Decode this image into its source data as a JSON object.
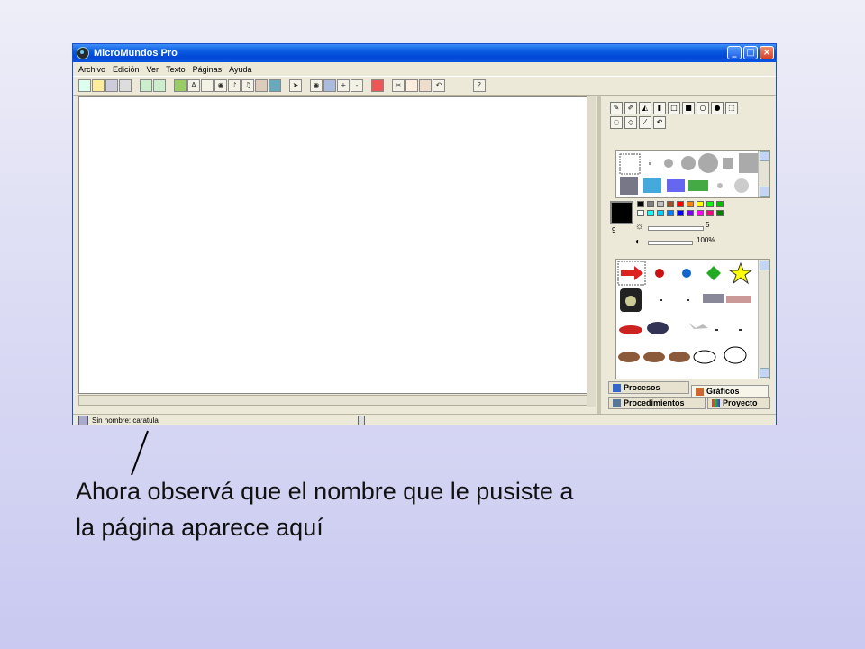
{
  "window": {
    "title": "MicroMundos Pro",
    "controls": {
      "minimize": "_",
      "maximize": "□",
      "close": "×"
    }
  },
  "menu": [
    "Archivo",
    "Edición",
    "Ver",
    "Texto",
    "Páginas",
    "Ayuda"
  ],
  "toolbar_icons": [
    "new-page-icon",
    "open-icon",
    "save-icon",
    "print-icon",
    "page-view-icon",
    "page-flip-icon",
    "turtle-icon",
    "text-box-icon",
    "button-tool-icon",
    "eye-icon",
    "music-icon",
    "melody-icon",
    "video-icon",
    "globe-icon",
    "pointer-icon",
    "eye-small-icon",
    "stamp-icon",
    "zoom-in-icon",
    "zoom-out-icon",
    "stop-icon",
    "cut-icon",
    "copy-icon",
    "paste-icon",
    "undo-icon",
    "help-icon"
  ],
  "status_bar": {
    "text": "Sin nombre:  caratula"
  },
  "palette": {
    "colors": [
      "#000000",
      "#808080",
      "#c0c0c0",
      "#a0522d",
      "#ff0000",
      "#ff8000",
      "#ffff00",
      "#00ff00",
      "#00c000",
      "#ffffff",
      "#00ffff",
      "#0080ff",
      "#0000ff",
      "#8000ff",
      "#ff00ff",
      "#ff0080",
      "#008000"
    ],
    "current_color": "#000000",
    "pen_size_value": "9",
    "brightness_value": "5",
    "opacity_value": "100%"
  },
  "tabs": {
    "procesos": "Procesos",
    "graficos": "Gráficos",
    "procedimientos": "Procedimientos",
    "proyecto": "Proyecto"
  },
  "caption": {
    "line1": "Ahora observá que el nombre que le pusiste a",
    "line2": "la página aparece aquí"
  },
  "colors": {
    "titlebar": "#0a5ae0",
    "window_bg": "#ece9d8",
    "slide_bg": "#dcdcf4"
  }
}
